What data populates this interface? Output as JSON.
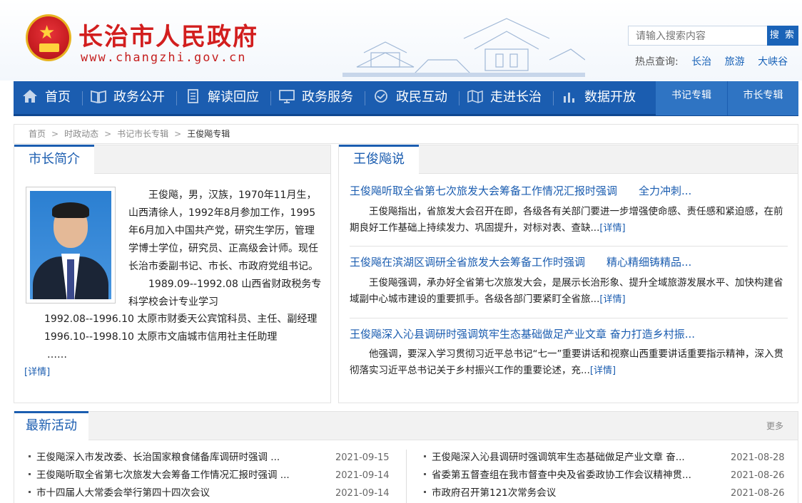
{
  "header": {
    "site_title": "长治市人民政府",
    "site_url": "www.changzhi.gov.cn",
    "search_placeholder": "请输入搜索内容",
    "search_button": "搜 索",
    "hot_label": "热点查询:",
    "hot_links": [
      "长治",
      "旅游",
      "大峡谷"
    ]
  },
  "nav": {
    "items": [
      {
        "label": "首页",
        "icon": "home-icon"
      },
      {
        "label": "政务公开",
        "icon": "book-icon"
      },
      {
        "label": "解读回应",
        "icon": "document-icon"
      },
      {
        "label": "政务服务",
        "icon": "monitor-icon"
      },
      {
        "label": "政民互动",
        "icon": "handshake-icon"
      },
      {
        "label": "走进长治",
        "icon": "map-icon"
      },
      {
        "label": "数据开放",
        "icon": "bar-chart-icon"
      }
    ],
    "special": [
      "书记专辑",
      "市长专辑"
    ]
  },
  "breadcrumb": [
    "首页",
    "时政动态",
    "书记市长专辑",
    "王俊飚专辑"
  ],
  "profile": {
    "tab": "市长简介",
    "bio_lines": [
      "王俊飚，男，汉族，1970年11月生，山西清徐人，1992年8月参加工作，1995年6月加入中国共产党，研究生学历，管理学博士学位，研究员、正高级会计师。现任长治市委副书记、市长、市政府党组书记。",
      "1989.09--1992.08 山西省财政税务专科学校会计专业学习"
    ],
    "career": [
      "1992.08--1996.10 太原市财委天公宾馆科员、主任、副经理",
      "1996.10--1998.10 太原市文庙城市信用社主任助理",
      "……"
    ],
    "detail_link": "[详情]"
  },
  "speeches": {
    "tab": "王俊飚说",
    "items": [
      {
        "title": "王俊飚听取全省第七次旅发大会筹备工作情况汇报时强调",
        "title_tail": "全力冲刺...",
        "body": "王俊飚指出，省旅发大会召开在即，各级各有关部门要进一步增强使命感、责任感和紧迫感，在前期良好工作基础上持续发力、巩固提升，对标对表、查缺...",
        "link": "[详情]"
      },
      {
        "title": "王俊飚在滨湖区调研全省旅发大会筹备工作时强调",
        "title_tail": "精心精细铸精品...",
        "body": "王俊飚强调，承办好全省第七次旅发大会，是展示长治形象、提升全域旅游发展水平、加快构建省域副中心城市建设的重要抓手。各级各部门要紧盯全省旅...",
        "link": "[详情]"
      },
      {
        "title": "王俊飚深入沁县调研时强调筑牢生态基础做足产业文章 奋力打造乡村振...",
        "title_tail": "",
        "body": "他强调，要深入学习贯彻习近平总书记“七一”重要讲话和视察山西重要讲话重要指示精神，深入贯彻落实习近平总书记关于乡村振兴工作的重要论述，充...",
        "link": "[详情]"
      }
    ]
  },
  "latest": {
    "tab": "最新活动",
    "more": "更多",
    "left": [
      {
        "title": "王俊飚深入市发改委、长治国家粮食储备库调研时强调  ...",
        "date": "2021-09-15"
      },
      {
        "title": "王俊飚听取全省第七次旅发大会筹备工作情况汇报时强调 ...",
        "date": "2021-09-14"
      },
      {
        "title": "市十四届人大常委会举行第四十四次会议",
        "date": "2021-09-14"
      }
    ],
    "right": [
      {
        "title": "王俊飚深入沁县调研时强调筑牢生态基础做足产业文章 奋...",
        "date": "2021-08-28"
      },
      {
        "title": "省委第五督查组在我市督查中央及省委政协工作会议精神贯...",
        "date": "2021-08-26"
      },
      {
        "title": "市政府召开第121次常务会议",
        "date": "2021-08-26"
      }
    ]
  }
}
